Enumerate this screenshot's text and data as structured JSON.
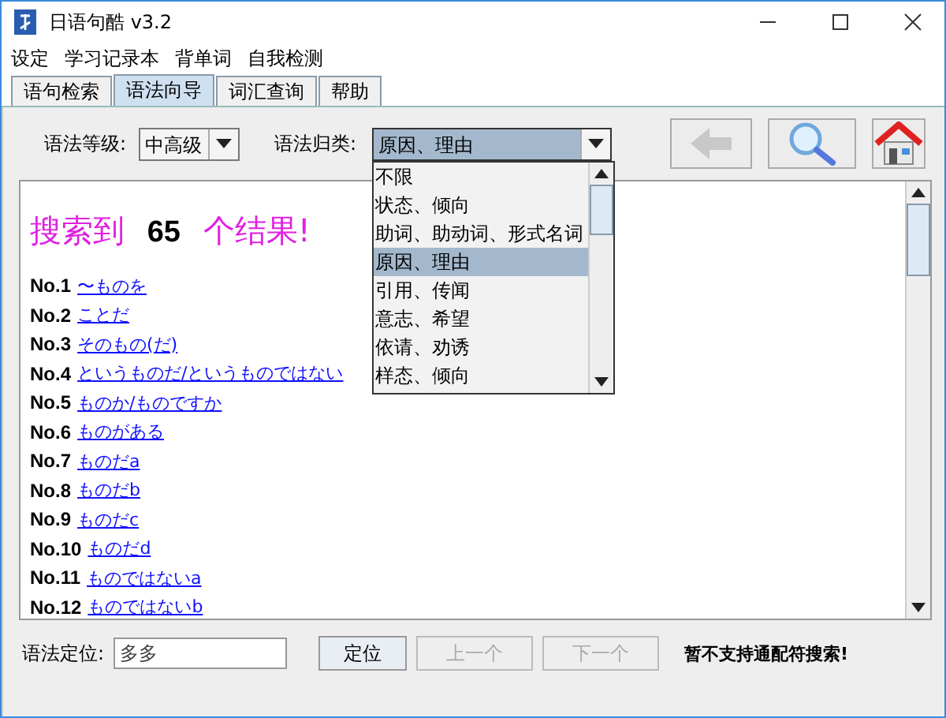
{
  "window": {
    "title": "日语句酷 v3.2"
  },
  "menu": [
    "设定",
    "学习记录本",
    "背单词",
    "自我检测"
  ],
  "tabs": [
    {
      "label": "语句检索",
      "selected": false
    },
    {
      "label": "语法向导",
      "selected": true
    },
    {
      "label": "词汇查询",
      "selected": false
    },
    {
      "label": "帮助",
      "selected": false
    }
  ],
  "level_select": {
    "label": "语法等级:",
    "value": "中高级"
  },
  "category_select": {
    "label": "语法归类:",
    "value": "原因、理由",
    "expanded": true,
    "options": [
      {
        "label": "不限",
        "selected": false
      },
      {
        "label": "状态、倾向",
        "selected": false
      },
      {
        "label": "助词、助动词、形式名词",
        "selected": false
      },
      {
        "label": "原因、理由",
        "selected": true
      },
      {
        "label": "引用、传闻",
        "selected": false
      },
      {
        "label": "意志、希望",
        "selected": false
      },
      {
        "label": "依请、劝诱",
        "selected": false
      },
      {
        "label": "样态、倾向",
        "selected": false
      }
    ]
  },
  "toolbar": {
    "back_disabled": true
  },
  "results": {
    "prefix": "搜索到",
    "count": "65",
    "suffix": "个结果!",
    "items": [
      {
        "no": "No.1",
        "text": "〜ものを"
      },
      {
        "no": "No.2",
        "text": "ことだ"
      },
      {
        "no": "No.3",
        "text": "そのもの(だ)"
      },
      {
        "no": "No.4",
        "text": "というものだ/というものではない"
      },
      {
        "no": "No.5",
        "text": "ものか/ものですか"
      },
      {
        "no": "No.6",
        "text": "ものがある"
      },
      {
        "no": "No.7",
        "text": "ものだa"
      },
      {
        "no": "No.8",
        "text": "ものだb"
      },
      {
        "no": "No.9",
        "text": "ものだc"
      },
      {
        "no": "No.10",
        "text": "ものだd"
      },
      {
        "no": "No.11",
        "text": "ものではないa"
      },
      {
        "no": "No.12",
        "text": "ものではないb"
      }
    ]
  },
  "footer": {
    "label": "语法定位:",
    "value": "多多",
    "locate": "定位",
    "prev": {
      "label": "上一个",
      "disabled": true
    },
    "next": {
      "label": "下一个",
      "disabled": true
    },
    "note": "暂不支持通配符搜索!"
  }
}
